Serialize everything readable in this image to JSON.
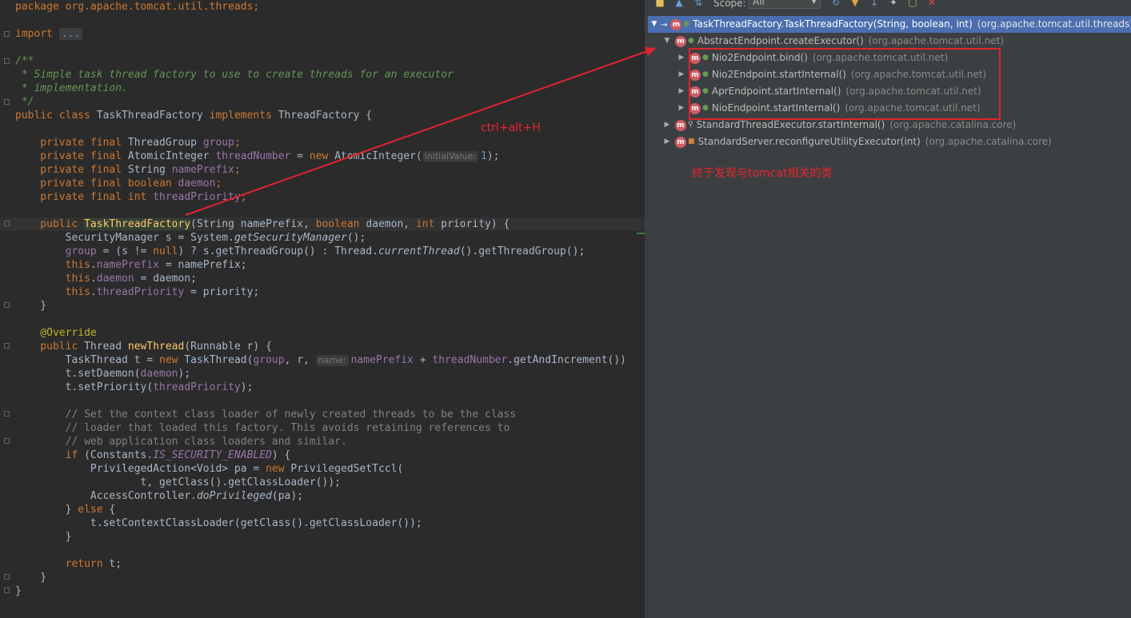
{
  "editor": {
    "lines": {
      "l01": "package org.apache.tomcat.util.threads;",
      "l03_kw": "import ",
      "l03_fold": "...",
      "l05": "/**",
      "l06": " * Simple task thread factory to use to create threads for an executor",
      "l07": " * implementation.",
      "l08": " */",
      "l09_a": "public class ",
      "l09_b": "TaskThreadFactory ",
      "l09_c": "implements ",
      "l09_d": "ThreadFactory {",
      "l11_a": "    private final ",
      "l11_b": "ThreadGroup ",
      "l11_c": "group",
      "l11_d": ";",
      "l12_a": "    private final ",
      "l12_b": "AtomicInteger ",
      "l12_c": "threadNumber",
      "l12_d": " = ",
      "l12_e": "new ",
      "l12_f": "AtomicInteger(",
      "l12_hint": "initialValue:",
      "l12_g": "1",
      "l12_h": ");",
      "l13_a": "    private final ",
      "l13_b": "String ",
      "l13_c": "namePrefix",
      "l13_d": ";",
      "l14_a": "    private final boolean ",
      "l14_c": "daemon",
      "l14_d": ";",
      "l15_a": "    private final int ",
      "l15_c": "threadPriority",
      "l15_d": ";",
      "l17_a": "    public ",
      "l17_b": "TaskThreadFactory",
      "l17_c": "(String namePrefix, ",
      "l17_d": "boolean ",
      "l17_e": "daemon, ",
      "l17_f": "int ",
      "l17_g": "priority) {",
      "l18_a": "        SecurityManager s = System.",
      "l18_b": "getSecurityManager",
      "l18_c": "();",
      "l19_a": "        ",
      "l19_b": "group",
      "l19_c": " = (s != ",
      "l19_d": "null",
      "l19_e": ") ? s.getThreadGroup() : Thread.",
      "l19_f": "currentThread",
      "l19_g": "().getThreadGroup();",
      "l20_a": "        this",
      "l20_b": ".",
      "l20_c": "namePrefix",
      "l20_d": " = namePrefix;",
      "l21_a": "        this",
      "l21_b": ".",
      "l21_c": "daemon",
      "l21_d": " = daemon;",
      "l22_a": "        this",
      "l22_b": ".",
      "l22_c": "threadPriority",
      "l22_d": " = priority;",
      "l23": "    }",
      "l25": "    @Override",
      "l26_a": "    public ",
      "l26_b": "Thread ",
      "l26_c": "newThread",
      "l26_d": "(Runnable r) {",
      "l27_a": "        TaskThread t = ",
      "l27_b": "new ",
      "l27_c": "TaskThread(",
      "l27_d": "group",
      "l27_e": ", r, ",
      "l27_hint": "name:",
      "l27_f": "namePrefix",
      "l27_g": " + ",
      "l27_h": "threadNumber",
      "l27_i": ".getAndIncrement())",
      "l28_a": "        t.setDaemon(",
      "l28_b": "daemon",
      "l28_c": ");",
      "l29_a": "        t.setPriority(",
      "l29_b": "threadPriority",
      "l29_c": ");",
      "l31": "        // Set the context class loader of newly created threads to be the class",
      "l32": "        // loader that loaded this factory. This avoids retaining references to",
      "l33": "        // web application class loaders and similar.",
      "l34_a": "        if ",
      "l34_b": "(Constants.",
      "l34_c": "IS_SECURITY_ENABLED",
      "l34_d": ") {",
      "l35_a": "            PrivilegedAction<Void> pa = ",
      "l35_b": "new ",
      "l35_c": "PrivilegedSetTccl(",
      "l36": "                    t, getClass().getClassLoader());",
      "l37_a": "            AccessController.",
      "l37_b": "doPrivileged",
      "l37_c": "(pa);",
      "l38_a": "        } ",
      "l38_b": "else ",
      "l38_c": "{",
      "l39": "            t.setContextClassLoader(getClass().getClassLoader());",
      "l40": "        }",
      "l42_a": "        return ",
      "l42_b": "t;",
      "l43": "    }",
      "l44": "}"
    }
  },
  "hierarchy": {
    "scope_label": "Scope:",
    "scope_value": "All",
    "rows": [
      {
        "method": "TaskThreadFactory.TaskThreadFactory(String, boolean, int)",
        "pkg": "(org.apache.tomcat.util.threads)"
      },
      {
        "method": "AbstractEndpoint.createExecutor()",
        "pkg": "(org.apache.tomcat.util.net)"
      },
      {
        "method": "Nio2Endpoint.bind()",
        "pkg": "(org.apache.tomcat.util.net)"
      },
      {
        "method": "Nio2Endpoint.startInternal()",
        "pkg": "(org.apache.tomcat.util.net)"
      },
      {
        "method": "AprEndpoint.startInternal()",
        "pkg": "(org.apache.tomcat.util.net)"
      },
      {
        "method": "NioEndpoint.startInternal()",
        "pkg": "(org.apache.tomcat.util.net)"
      },
      {
        "method": "StandardThreadExecutor.startInternal()",
        "pkg": "(org.apache.catalina.core)"
      },
      {
        "method": "StandardServer.reconfigureUtilityExecutor(int)",
        "pkg": "(org.apache.catalina.core)"
      }
    ]
  },
  "annotations": {
    "shortcut": "ctrl+alt+H",
    "note": "终于发现与tomcat相关的类"
  },
  "colors": {
    "annotation_red": "#e0242c",
    "selection": "#4b6eaf",
    "method_icon": "#d05b63"
  }
}
